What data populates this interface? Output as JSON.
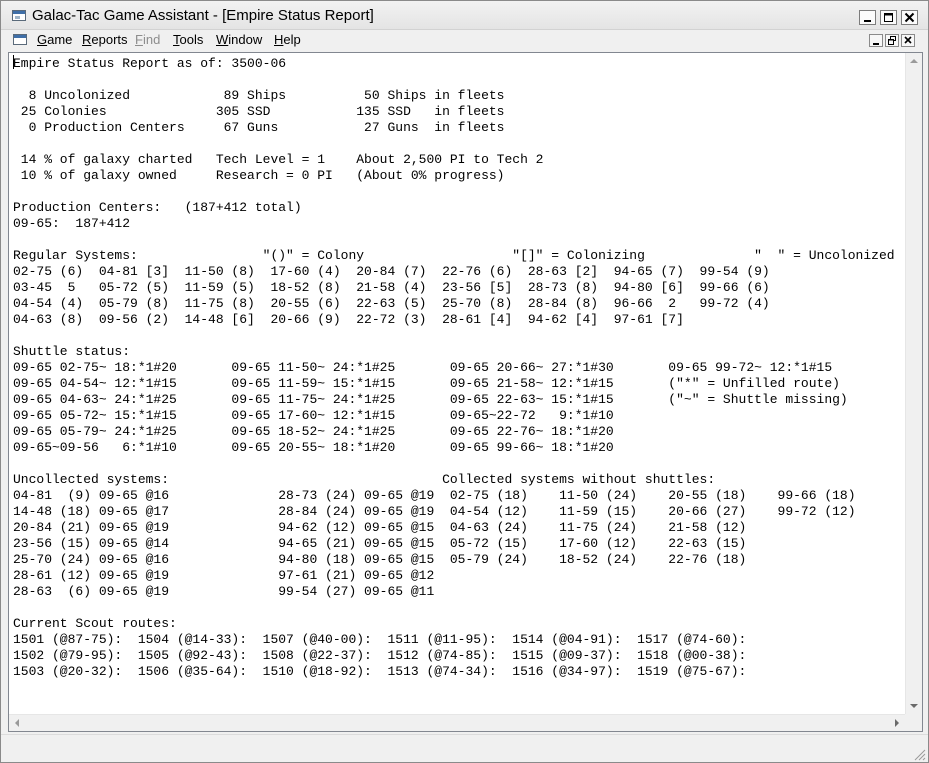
{
  "window": {
    "title": "Galac-Tac Game Assistant - [Empire Status Report]"
  },
  "menu": {
    "items": [
      {
        "label": "Game",
        "hotkey_index": 0,
        "enabled": true
      },
      {
        "label": "Reports",
        "hotkey_index": 0,
        "enabled": true
      },
      {
        "label": "Find",
        "hotkey_index": 0,
        "enabled": false
      },
      {
        "label": "Tools",
        "hotkey_index": 0,
        "enabled": true
      },
      {
        "label": "Window",
        "hotkey_index": 0,
        "enabled": true
      },
      {
        "label": "Help",
        "hotkey_index": 0,
        "enabled": true
      }
    ]
  },
  "report": {
    "lines": [
      "Empire Status Report as of: 3500-06",
      "",
      "  8 Uncolonized            89 Ships          50 Ships in fleets",
      " 25 Colonies              305 SSD           135 SSD   in fleets",
      "  0 Production Centers     67 Guns           27 Guns  in fleets",
      "",
      " 14 % of galaxy charted   Tech Level = 1    About 2,500 PI to Tech 2",
      " 10 % of galaxy owned     Research = 0 PI   (About 0% progress)",
      "",
      "Production Centers:   (187+412 total)",
      "09-65:  187+412",
      "",
      "Regular Systems:                \"()\" = Colony                   \"[]\" = Colonizing              \"  \" = Uncolonized",
      "02-75 (6)  04-81 [3]  11-50 (8)  17-60 (4)  20-84 (7)  22-76 (6)  28-63 [2]  94-65 (7)  99-54 (9)",
      "03-45  5   05-72 (5)  11-59 (5)  18-52 (8)  21-58 (4)  23-56 [5]  28-73 (8)  94-80 [6]  99-66 (6)",
      "04-54 (4)  05-79 (8)  11-75 (8)  20-55 (6)  22-63 (5)  25-70 (8)  28-84 (8)  96-66  2   99-72 (4)",
      "04-63 (8)  09-56 (2)  14-48 [6]  20-66 (9)  22-72 (3)  28-61 [4]  94-62 [4]  97-61 [7]",
      "",
      "Shuttle status:",
      "09-65 02-75~ 18:*1#20       09-65 11-50~ 24:*1#25       09-65 20-66~ 27:*1#30       09-65 99-72~ 12:*1#15",
      "09-65 04-54~ 12:*1#15       09-65 11-59~ 15:*1#15       09-65 21-58~ 12:*1#15       (\"*\" = Unfilled route)",
      "09-65 04-63~ 24:*1#25       09-65 11-75~ 24:*1#25       09-65 22-63~ 15:*1#15       (\"~\" = Shuttle missing)",
      "09-65 05-72~ 15:*1#15       09-65 17-60~ 12:*1#15       09-65~22-72   9:*1#10",
      "09-65 05-79~ 24:*1#25       09-65 18-52~ 24:*1#25       09-65 22-76~ 18:*1#20",
      "09-65~09-56   6:*1#10       09-65 20-55~ 18:*1#20       09-65 99-66~ 18:*1#20",
      "",
      "Uncollected systems:                                   Collected systems without shuttles:",
      "04-81  (9) 09-65 @16              28-73 (24) 09-65 @19  02-75 (18)    11-50 (24)    20-55 (18)    99-66 (18)",
      "14-48 (18) 09-65 @17              28-84 (24) 09-65 @19  04-54 (12)    11-59 (15)    20-66 (27)    99-72 (12)",
      "20-84 (21) 09-65 @19              94-62 (12) 09-65 @15  04-63 (24)    11-75 (24)    21-58 (12)",
      "23-56 (15) 09-65 @14              94-65 (21) 09-65 @15  05-72 (15)    17-60 (12)    22-63 (15)",
      "25-70 (24) 09-65 @16              94-80 (18) 09-65 @15  05-79 (24)    18-52 (24)    22-76 (18)",
      "28-61 (12) 09-65 @19              97-61 (21) 09-65 @12",
      "28-63  (6) 09-65 @19              99-54 (27) 09-65 @11",
      "",
      "Current Scout routes:",
      "1501 (@87-75):  1504 (@14-33):  1507 (@40-00):  1511 (@11-95):  1514 (@04-91):  1517 (@74-60):",
      "1502 (@79-95):  1505 (@92-43):  1508 (@22-37):  1512 (@74-85):  1515 (@09-37):  1518 (@00-38):",
      "1503 (@20-32):  1506 (@35-64):  1510 (@18-92):  1513 (@74-34):  1516 (@34-97):  1519 (@75-67):"
    ]
  },
  "icons": {
    "app": "app-window-icon",
    "minimize": "minimize-icon",
    "maximize": "maximize-icon",
    "close": "close-icon",
    "restore": "restore-icon",
    "scroll_up": "arrow-up-icon",
    "scroll_down": "arrow-down-icon",
    "scroll_left": "arrow-left-icon",
    "scroll_right": "arrow-right-icon",
    "grip": "resize-grip-icon"
  },
  "colors": {
    "text": "#000000",
    "disabled_text": "#8d8d8d",
    "document_bg": "#ffffff",
    "chrome_bg": "#f0f0f0",
    "title_icon_accent": "#3f6fa8"
  }
}
